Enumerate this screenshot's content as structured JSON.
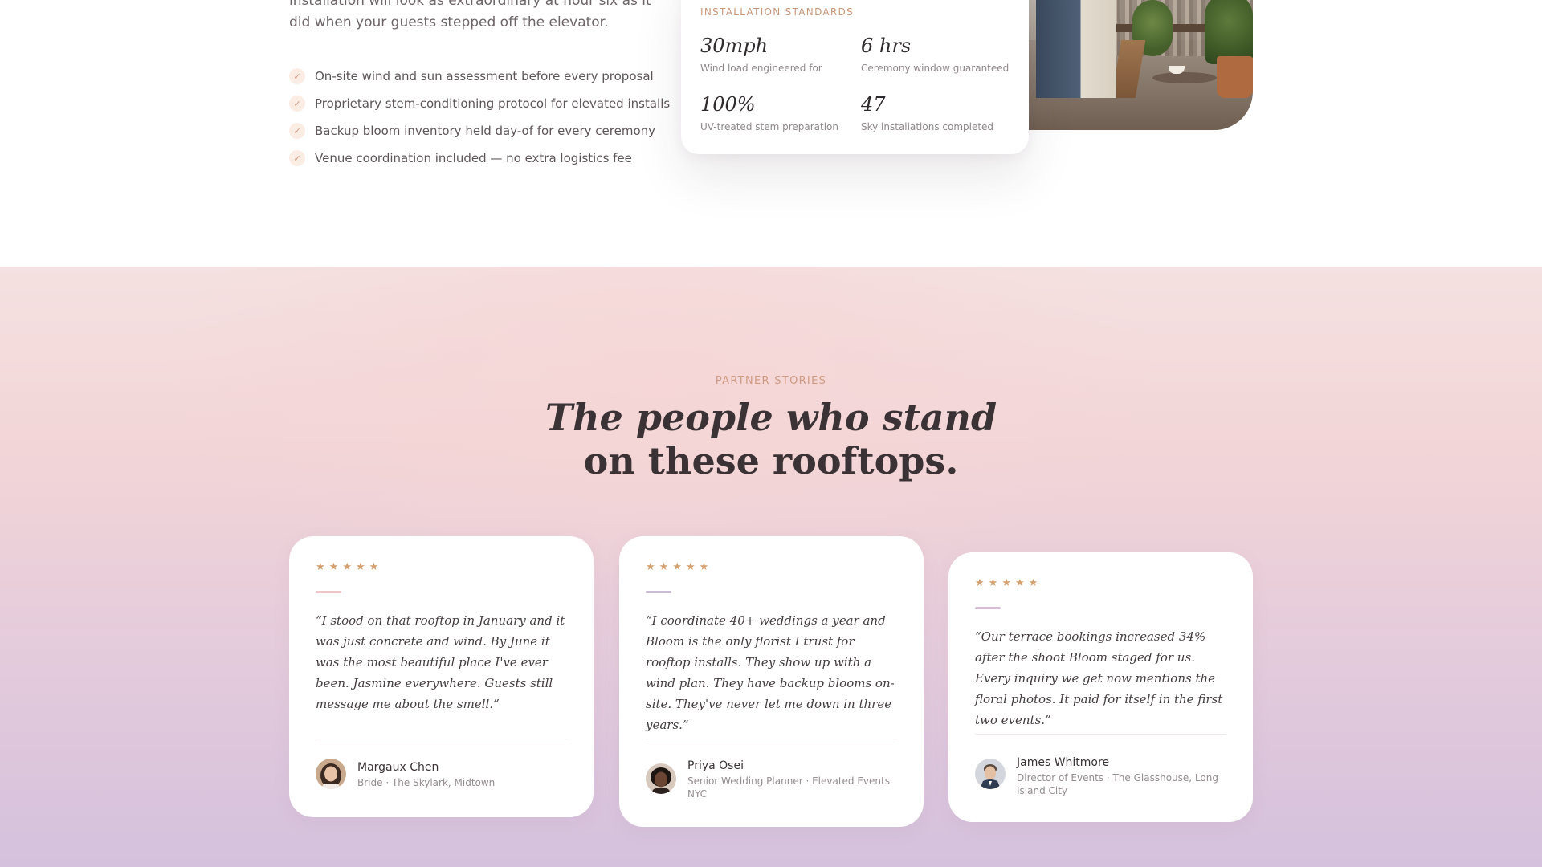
{
  "intro": {
    "text": "installation will look as extraordinary at hour six as it did when your guests stepped off the elevator."
  },
  "features": [
    "On-site wind and sun assessment before every proposal",
    "Proprietary stem-conditioning protocol for elevated installs",
    "Backup bloom inventory held day-of for every ceremony",
    "Venue coordination included — no extra logistics fee"
  ],
  "standards": {
    "title": "INSTALLATION STANDARDS",
    "stats": [
      {
        "value": "30mph",
        "label": "Wind load engineered for"
      },
      {
        "value": "6 hrs",
        "label": "Ceremony window guaranteed"
      },
      {
        "value": "100%",
        "label": "UV-treated stem preparation"
      },
      {
        "value": "47",
        "label": "Sky installations completed"
      }
    ]
  },
  "stories": {
    "eyebrow": "PARTNER STORIES",
    "headline_line1": "The people who stand",
    "headline_line2": "on these rooftops.",
    "testimonials": [
      {
        "stars": 5,
        "accent_color": "#f0c4c6",
        "quote": "“I stood on that rooftop in January and it was just concrete and wind. By June it was the most beautiful place I've ever been. Jasmine everywhere. Guests still message me about the smell.”",
        "name": "Margaux Chen",
        "role": "Bride · The Skylark, Midtown"
      },
      {
        "stars": 5,
        "accent_color": "#cbbcd6",
        "quote": "“I coordinate 40+ weddings a year and Bloom is the only florist I trust for rooftop installs. They show up with a wind plan. They have backup blooms on-site. They've never let me down in three years.”",
        "name": "Priya Osei",
        "role": "Senior Wedding Planner · Elevated Events NYC"
      },
      {
        "stars": 5,
        "accent_color": "#d5bed6",
        "quote": "“Our terrace bookings increased 34% after the shoot Bloom staged for us. Every inquiry we get now mentions the floral photos. It paid for itself in the first two events.”",
        "name": "James Whitmore",
        "role": "Director of Events · The Glasshouse, Long Island City"
      }
    ]
  },
  "icons": {
    "check": "check-icon",
    "star": "star-icon"
  },
  "colors": {
    "accent_gold": "#d4a06f",
    "eyebrow": "#cf9a80",
    "background_pink": "#f2d5d7",
    "background_lavender": "#d5c1dd"
  }
}
